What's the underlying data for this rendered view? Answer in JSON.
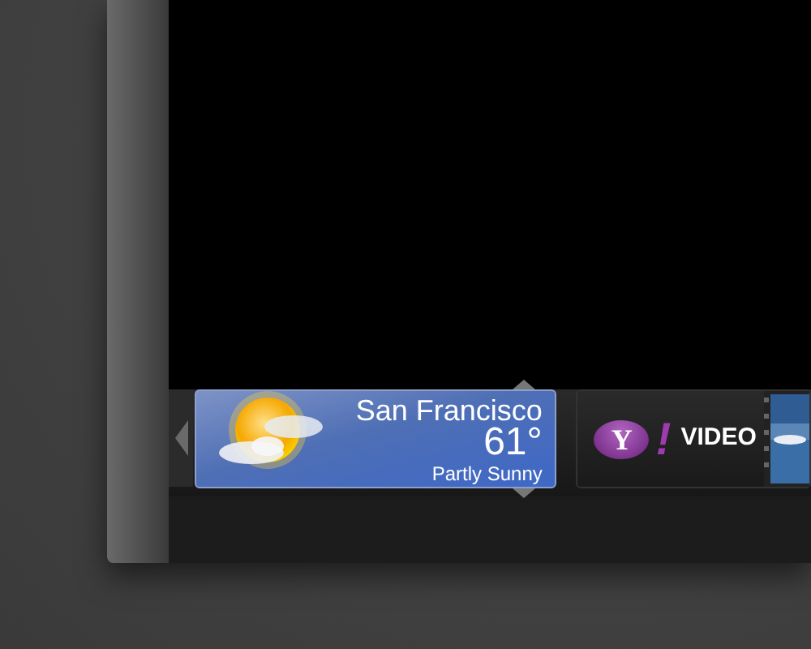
{
  "dock": {
    "widgets": [
      {
        "kind": "weather",
        "selected": true,
        "city": "San Francisco",
        "temperature": "61°",
        "condition": "Partly Sunny"
      },
      {
        "kind": "video",
        "selected": false,
        "logo_letter": "Y",
        "logo_mark": "!",
        "label": "VIDEO"
      }
    ]
  }
}
